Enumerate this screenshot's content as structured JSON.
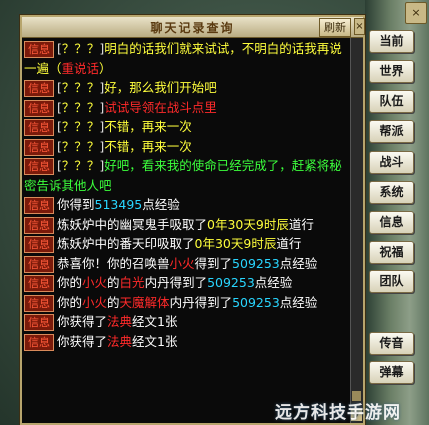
{
  "window": {
    "title": "聊天记录查询",
    "refresh_label": "刷新",
    "close_label": "×"
  },
  "menu": [
    {
      "label": "当前"
    },
    {
      "label": "世界"
    },
    {
      "label": "队伍"
    },
    {
      "label": "帮派"
    },
    {
      "label": "战斗"
    },
    {
      "label": "系统"
    },
    {
      "label": "信息"
    },
    {
      "label": "祝福"
    },
    {
      "label": "团队"
    },
    {
      "label": "传音"
    },
    {
      "label": "弹幕"
    }
  ],
  "messages": [
    {
      "tag": "信息",
      "parts": [
        {
          "t": "[",
          "c": "q"
        },
        {
          "t": "？？？",
          "c": "y"
        },
        {
          "t": "]",
          "c": "q"
        },
        {
          "t": "明白的话我们就来试试，不明白的话我再说一遍（",
          "c": "y"
        },
        {
          "t": "重说话",
          "c": "r"
        },
        {
          "t": "）",
          "c": "y"
        }
      ]
    },
    {
      "tag": "信息",
      "parts": [
        {
          "t": "[",
          "c": "q"
        },
        {
          "t": "？？？",
          "c": "y"
        },
        {
          "t": "]",
          "c": "q"
        },
        {
          "t": "好，那么我们开始吧",
          "c": "y"
        }
      ]
    },
    {
      "tag": "信息",
      "parts": [
        {
          "t": "[",
          "c": "q"
        },
        {
          "t": "？？？",
          "c": "y"
        },
        {
          "t": "]",
          "c": "q"
        },
        {
          "t": "试试导领在战斗点里",
          "c": "r"
        }
      ]
    },
    {
      "tag": "信息",
      "parts": [
        {
          "t": "[",
          "c": "q"
        },
        {
          "t": "？？？",
          "c": "y"
        },
        {
          "t": "]",
          "c": "q"
        },
        {
          "t": "不错，再来一次",
          "c": "y"
        }
      ]
    },
    {
      "tag": "信息",
      "parts": [
        {
          "t": "[",
          "c": "q"
        },
        {
          "t": "？？？",
          "c": "y"
        },
        {
          "t": "]",
          "c": "q"
        },
        {
          "t": "不错，再来一次",
          "c": "y"
        }
      ]
    },
    {
      "tag": "信息",
      "parts": [
        {
          "t": "[",
          "c": "q"
        },
        {
          "t": "？？？",
          "c": "y"
        },
        {
          "t": "]",
          "c": "q"
        },
        {
          "t": "好吧，看来我的使命已经完成了，赶紧将秘密告诉其他人吧",
          "c": "g"
        }
      ]
    },
    {
      "tag": "信息",
      "parts": [
        {
          "t": "你得到",
          "c": "w"
        },
        {
          "t": "513495",
          "c": "c"
        },
        {
          "t": "点经验",
          "c": "w"
        }
      ]
    },
    {
      "tag": "信息",
      "parts": [
        {
          "t": "炼妖炉中的幽冥鬼手吸取了",
          "c": "w"
        },
        {
          "t": "0年30天9时辰",
          "c": "y"
        },
        {
          "t": "道行",
          "c": "w"
        }
      ]
    },
    {
      "tag": "信息",
      "parts": [
        {
          "t": "炼妖炉中的番天印吸取了",
          "c": "w"
        },
        {
          "t": "0年30天9时辰",
          "c": "y"
        },
        {
          "t": "道行",
          "c": "w"
        }
      ]
    },
    {
      "tag": "信息",
      "parts": [
        {
          "t": "恭喜你！你的召唤兽",
          "c": "w"
        },
        {
          "t": "小火",
          "c": "r"
        },
        {
          "t": "得到了",
          "c": "w"
        },
        {
          "t": "509253",
          "c": "c"
        },
        {
          "t": "点经验",
          "c": "w"
        }
      ]
    },
    {
      "tag": "信息",
      "parts": [
        {
          "t": "你的",
          "c": "w"
        },
        {
          "t": "小火",
          "c": "r"
        },
        {
          "t": "的",
          "c": "w"
        },
        {
          "t": "白光",
          "c": "r"
        },
        {
          "t": "内丹得到了",
          "c": "w"
        },
        {
          "t": "509253",
          "c": "c"
        },
        {
          "t": "点经验",
          "c": "w"
        }
      ]
    },
    {
      "tag": "信息",
      "parts": [
        {
          "t": "你的",
          "c": "w"
        },
        {
          "t": "小火",
          "c": "r"
        },
        {
          "t": "的",
          "c": "w"
        },
        {
          "t": "天魔解体",
          "c": "r"
        },
        {
          "t": "内丹得到了",
          "c": "w"
        },
        {
          "t": "509253",
          "c": "c"
        },
        {
          "t": "点经验",
          "c": "w"
        }
      ]
    },
    {
      "tag": "信息",
      "parts": [
        {
          "t": "你获得了",
          "c": "w"
        },
        {
          "t": "法典",
          "c": "r"
        },
        {
          "t": "经文1张",
          "c": "w"
        }
      ]
    },
    {
      "tag": "信息",
      "parts": [
        {
          "t": "你获得了",
          "c": "w"
        },
        {
          "t": "法典",
          "c": "r"
        },
        {
          "t": "经文1张",
          "c": "w"
        }
      ]
    }
  ],
  "corner_label": "×",
  "watermark": "远方科技手游网"
}
